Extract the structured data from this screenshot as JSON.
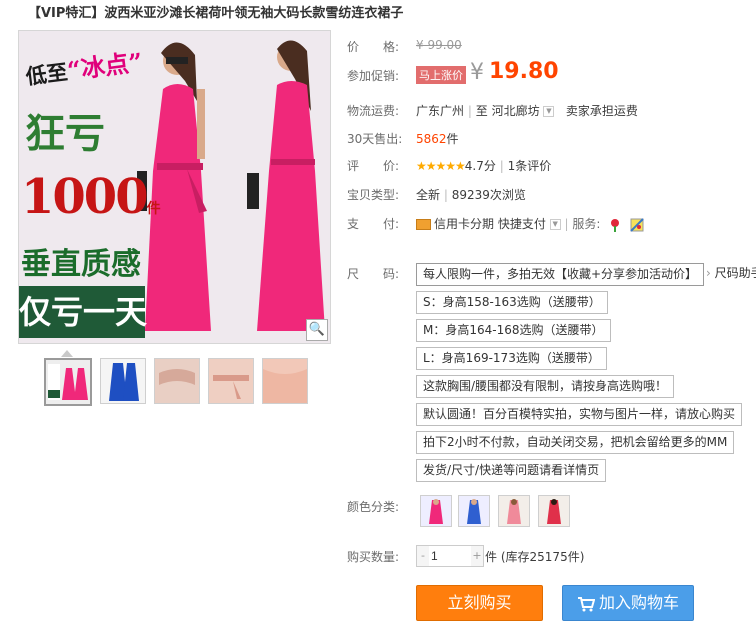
{
  "title": "【VIP特汇】波西米亚沙滩长裙荷叶领无袖大码长款雪纺连衣裙子",
  "image": {
    "promo_lines": [
      "低至",
      "“冰点”",
      "狂亏",
      "1000",
      "件",
      "垂直质感",
      "仅亏一天"
    ],
    "zoom_icon": "magnifier-icon"
  },
  "info": {
    "price_label": "价　　格:",
    "original_price": "¥ 99.00",
    "promo_label": "参加促销:",
    "promo_badge": "马上涨价",
    "currency": "¥",
    "promo_price": "19.80",
    "shipping_label": "物流运费:",
    "shipping_from": "广东广州",
    "shipping_sep": "至",
    "shipping_to": "河北廊坊",
    "shipping_fee": "卖家承担运费",
    "sold_label": "30天售出:",
    "sold_count": "5862",
    "sold_unit": "件",
    "rating_label": "评　　价:",
    "rating_stars": "★★★★★",
    "rating_score": "4.7分",
    "rating_sep": "|",
    "review_count": "1条评价",
    "type_label": "宝贝类型:",
    "type_value": "全新",
    "type_sep": "|",
    "views": "89239次浏览",
    "pay_label": "支　　付:",
    "pay_card": "信用卡分期",
    "pay_quick": "快捷支付",
    "service_label": "服务:"
  },
  "size": {
    "label": "尺　　码:",
    "options": [
      "每人限购一件，多拍无效【收藏+分享参加活动价】",
      "S：身高158-163选购（送腰带）",
      "M：身高164-168选购（送腰带）",
      "L：身高169-173选购（送腰带）",
      "这款胸围/腰围都没有限制，请按身高选购哦！",
      "默认圆通！百分百模特实拍，实物与图片一样，请放心购买",
      "拍下2小时不付款，自动关闭交易，把机会留给更多的MM",
      "发货/尺寸/快递等问题请看详情页"
    ],
    "more_text": "尺码助手"
  },
  "color": {
    "label": "颜色分类:"
  },
  "quantity": {
    "label": "购买数量:",
    "value": "1",
    "minus": "-",
    "plus": "+",
    "unit": "件",
    "stock": "(库存25175件)"
  },
  "buttons": {
    "buy_now": "立刻购买",
    "add_cart": "加入购物车"
  },
  "colors": {
    "accent": "#ff4400",
    "buy_button": "#ff7e0d",
    "cart_button": "#4b9ee9",
    "badge": "#e26d6d",
    "stars": "#ffaa00"
  }
}
